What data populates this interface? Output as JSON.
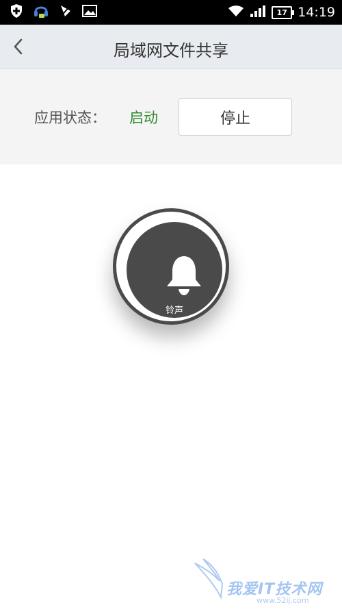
{
  "status_bar": {
    "time": "14:19",
    "battery": "17",
    "icons": [
      "shield-plus-icon",
      "headset-chat-icon",
      "no-signal-flag-icon",
      "image-icon",
      "wifi-icon",
      "signal-icon",
      "battery-icon"
    ]
  },
  "header": {
    "title": "局域网文件共享",
    "back_icon": "chevron-left-icon"
  },
  "status_panel": {
    "label": "应用状态：",
    "value": "启动",
    "value_color": "#2e8b2e",
    "stop_button": "停止"
  },
  "ringtone": {
    "label": "铃声",
    "icon": "bell-icon"
  },
  "watermark": {
    "text": "我爱IT技术网",
    "url": "www.52ij.com"
  }
}
